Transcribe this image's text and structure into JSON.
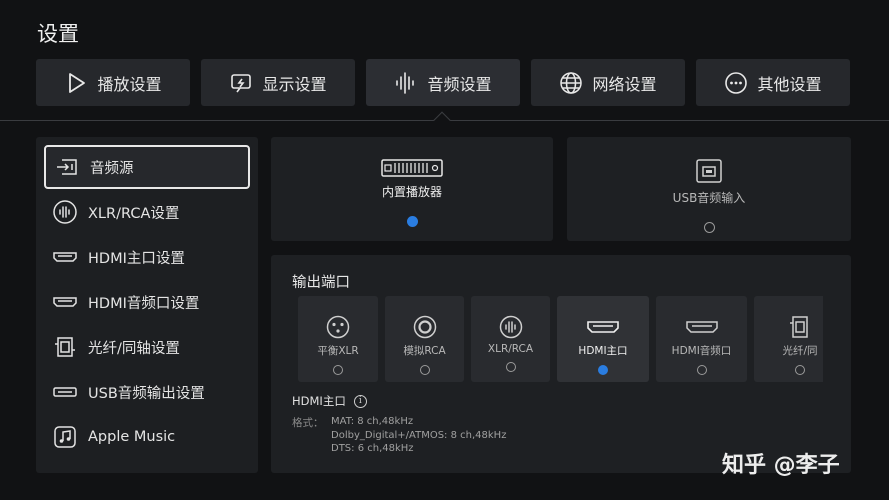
{
  "page_title": "设置",
  "tabs": [
    {
      "label": "播放设置",
      "icon": "play-icon"
    },
    {
      "label": "显示设置",
      "icon": "display-icon"
    },
    {
      "label": "音频设置",
      "icon": "audio-wave-icon",
      "active": true
    },
    {
      "label": "网络设置",
      "icon": "globe-icon"
    },
    {
      "label": "其他设置",
      "icon": "more-icon"
    }
  ],
  "sidebar": {
    "items": [
      {
        "label": "音频源",
        "icon": "audio-source-icon",
        "active": true
      },
      {
        "label": "XLR/RCA设置",
        "icon": "xlr-icon"
      },
      {
        "label": "HDMI主口设置",
        "icon": "hdmi-icon"
      },
      {
        "label": "HDMI音频口设置",
        "icon": "hdmi-icon"
      },
      {
        "label": "光纤/同轴设置",
        "icon": "optical-icon"
      },
      {
        "label": "USB音频输出设置",
        "icon": "usb-icon"
      },
      {
        "label": "Apple Music",
        "icon": "music-note-icon"
      }
    ]
  },
  "sources": [
    {
      "label": "内置播放器",
      "icon": "player-device-icon",
      "selected": true
    },
    {
      "label": "USB音频输入",
      "icon": "usb-b-icon",
      "selected": false
    }
  ],
  "output": {
    "title": "输出端口",
    "ports": [
      {
        "label": "平衡XLR",
        "icon": "xlr-port-icon",
        "selected": false
      },
      {
        "label": "模拟RCA",
        "icon": "rca-port-icon",
        "selected": false
      },
      {
        "label": "XLR/RCA",
        "icon": "xlr-rca-port-icon",
        "selected": false
      },
      {
        "label": "HDMI主口",
        "icon": "hdmi-port-icon",
        "selected": true
      },
      {
        "label": "HDMI音频口",
        "icon": "hdmi-port-icon",
        "selected": false
      },
      {
        "label": "光纤/同",
        "icon": "optical-port-icon",
        "selected": false
      }
    ],
    "format_title": "HDMI主口",
    "format_label": "格式：",
    "format_lines": [
      "MAT: 8 ch,48kHz",
      "Dolby_Digital+/ATMOS: 8 ch,48kHz",
      "DTS: 6 ch,48kHz"
    ]
  },
  "accent_color": "#2a7de1",
  "watermark": "知乎 @李子"
}
